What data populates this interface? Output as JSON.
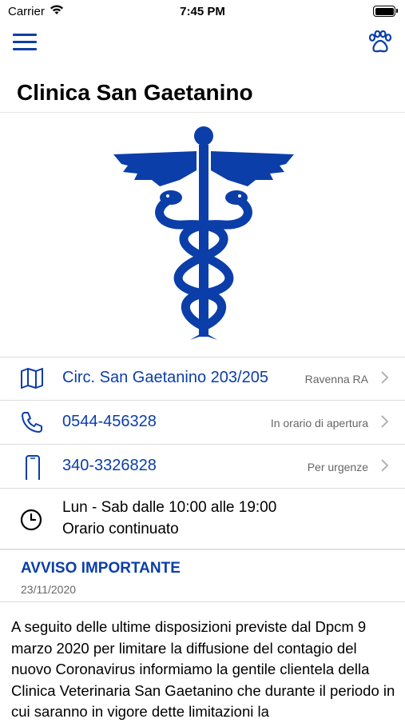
{
  "status_bar": {
    "carrier": "Carrier",
    "time": "7:45 PM"
  },
  "header": {
    "title": "Clinica San Gaetanino"
  },
  "contacts": [
    {
      "icon": "map-icon",
      "main": "Circ. San Gaetanino 203/205",
      "side": "Ravenna RA"
    },
    {
      "icon": "phone-icon",
      "main": "0544-456328",
      "side": "In orario di apertura"
    },
    {
      "icon": "mobile-icon",
      "main": "340-3326828",
      "side": "Per urgenze"
    }
  ],
  "hours": {
    "icon": "clock-icon",
    "line1": "Lun - Sab dalle 10:00 alle 19:00",
    "line2": "Orario continuato"
  },
  "notice": {
    "title": "AVVISO IMPORTANTE",
    "date": "23/11/2020",
    "body": "A seguito delle ultime disposizioni previste dal Dpcm 9 marzo 2020 per limitare la diffusione del contagio del nuovo Coronavirus informiamo la gentile clientela della Clinica Veterinaria San Gaetanino che durante il periodo in cui saranno in vigore dette limitazioni la"
  },
  "colors": {
    "accent": "#0b3ea8",
    "divider": "#dcdcdc",
    "secondary_text": "#666666"
  }
}
